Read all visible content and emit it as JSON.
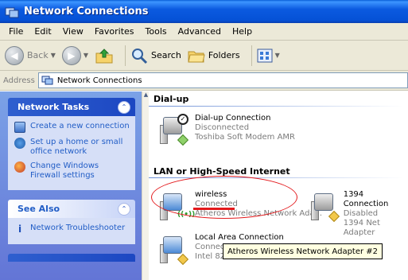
{
  "window": {
    "title": "Network Connections"
  },
  "menu": [
    "File",
    "Edit",
    "View",
    "Favorites",
    "Tools",
    "Advanced",
    "Help"
  ],
  "toolbar": {
    "back_label": "Back",
    "search_label": "Search",
    "folders_label": "Folders"
  },
  "address": {
    "label": "Address",
    "value": "Network Connections"
  },
  "tasks": {
    "network_tasks": {
      "title": "Network Tasks",
      "items": [
        "Create a new connection",
        "Set up a home or small office network",
        "Change Windows Firewall settings"
      ]
    },
    "see_also": {
      "title": "See Also",
      "items": [
        "Network Troubleshooter"
      ]
    }
  },
  "groups": {
    "dialup": {
      "title": "Dial-up",
      "connection": {
        "name": "Dial-up Connection",
        "status": "Disconnected",
        "device": "Toshiba Soft Modem AMR"
      }
    },
    "lan": {
      "title": "LAN or High-Speed Internet",
      "connections": [
        {
          "name": "wireless",
          "status": "Connected",
          "device": "Atheros Wireless Network Ada..."
        },
        {
          "name": "1394 Connection",
          "status": "Disabled",
          "device": "1394 Net Adapter"
        },
        {
          "name": "Local Area Connection",
          "status": "Connec",
          "device": "Intel 82"
        }
      ]
    }
  },
  "tooltip": "Atheros Wireless Network Adapter #2",
  "colors": {
    "annotation": "#e3191c",
    "title_bar": "#0551d6",
    "task_pane": "#6375d6"
  }
}
